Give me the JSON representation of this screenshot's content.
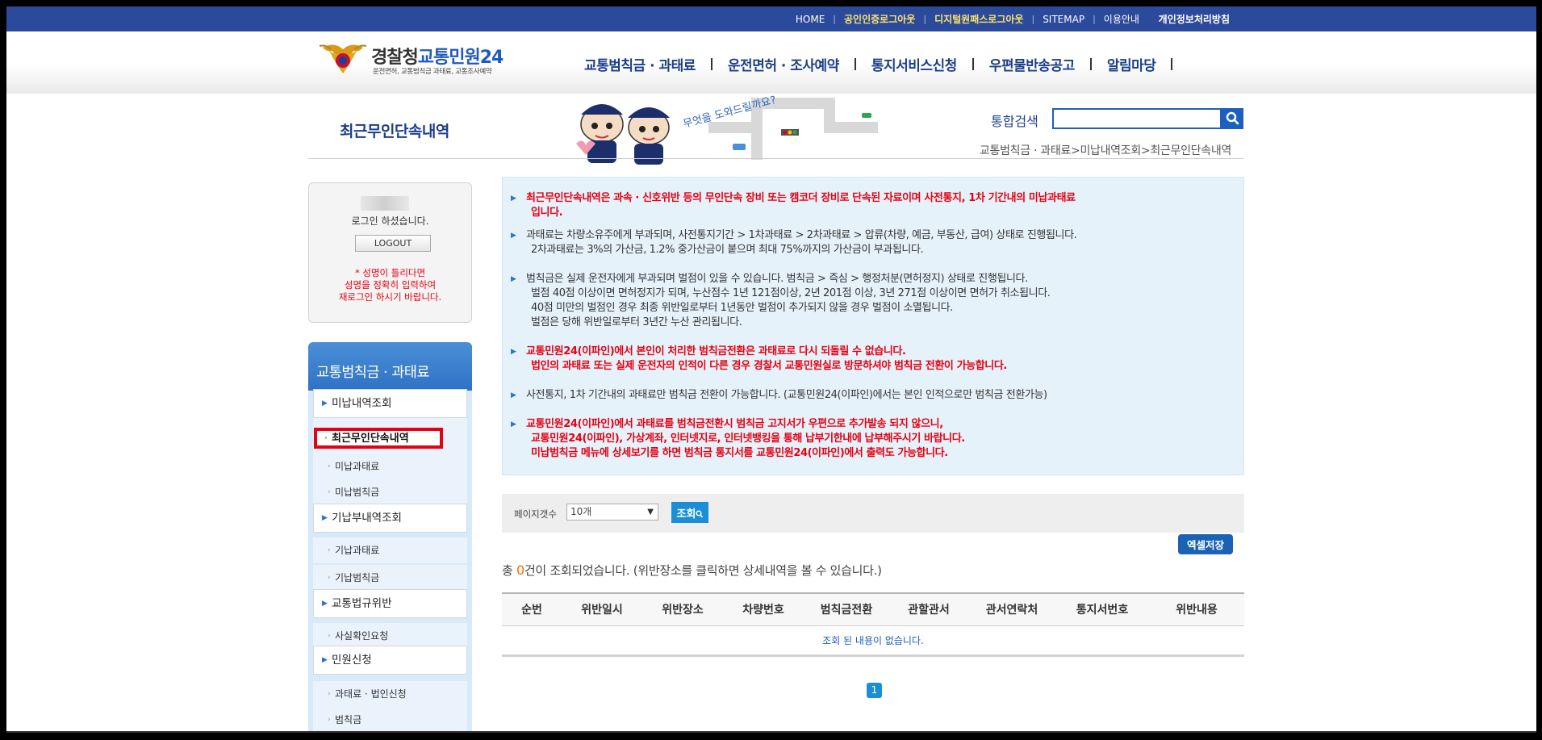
{
  "top_nav": {
    "items": [
      {
        "label": "HOME",
        "style": "normal"
      },
      {
        "label": "공인인증로그아웃",
        "style": "highlight"
      },
      {
        "label": "디지털원패스로그아웃",
        "style": "highlight"
      },
      {
        "label": "SITEMAP",
        "style": "normal"
      },
      {
        "label": "이용안내",
        "style": "normal"
      },
      {
        "label": "개인정보처리방침",
        "style": "bold"
      }
    ],
    "separator": "|"
  },
  "logo": {
    "title_a": "경찰청",
    "title_b": "교통민원24",
    "subtitle": "운전면허, 교통범칙금 과태료, 교통조사예약"
  },
  "gnb": {
    "items": [
      "교통범칙금 · 과태료",
      "운전면허 · 조사예약",
      "통지서비스신청",
      "우편물반송공고",
      "알림마당"
    ]
  },
  "page_title": "최근무인단속내역",
  "visual": {
    "caption": "무엇을 도와드릴까요?"
  },
  "search": {
    "label": "통합검색",
    "value": ""
  },
  "breadcrumb": "교통범칙금 · 과태료>미납내역조회>최근무인단속내역",
  "login": {
    "message": "로그인 하셨습니다.",
    "logout_label": "LOGOUT",
    "warning": [
      "* 성명이 틀리다면",
      "성명을 정확히 입력하여",
      "재로그인 하시기 바랍니다."
    ]
  },
  "lnb": {
    "title": "교통범칙금 · 과태료",
    "groups": [
      {
        "label": "미납내역조회",
        "children": [
          "최근무인단속내역",
          "미납과태료",
          "미납범칙금"
        ]
      },
      {
        "label": "기납부내역조회",
        "children": [
          "기납과태료",
          "기납범칙금"
        ]
      },
      {
        "label": "교통법규위반",
        "children": [
          "사실확인요청"
        ]
      },
      {
        "label": "민원신청",
        "children": [
          "과태료 · 법인신청",
          "범칙금"
        ]
      }
    ]
  },
  "notice": [
    {
      "red": true,
      "lines": [
        "최근무인단속내역은 과속 · 신호위반 등의 무인단속 장비 또는 캠코더 장비로 단속된 자료이며 사전통지, 1차 기간내의 미납과태료",
        "입니다."
      ]
    },
    {
      "red": false,
      "lines": [
        "과태료는 차량소유주에게 부과되며, 사전통지기간 > 1차과태료 > 2차과태료 > 압류(차량, 예금, 부동산, 급여) 상태로 진행됩니다.",
        "2차과태료는 3%의 가산금, 1.2% 중가산금이 붙으며 최대 75%까지의 가산금이 부과됩니다."
      ]
    },
    {
      "red": false,
      "lines": [
        "범칙금은 실제 운전자에게 부과되며 벌점이 있을 수 있습니다. 범칙금 > 즉심 > 행정처분(면허정지) 상태로 진행됩니다.",
        "벌점 40점 이상이면 면허정지가 되며, 누산점수 1년 121점이상, 2년 201점 이상, 3년 271점 이상이면 면허가 취소됩니다.",
        "40점 미만의 벌점인 경우 최종 위반일로부터 1년동안 벌점이 추가되지 않을 경우 벌점이 소멸됩니다.",
        "벌점은 당해 위반일로부터 3년간 누산 관리됩니다."
      ]
    },
    {
      "red": true,
      "lines": [
        "교통민원24(이파인)에서 본인이 처리한 범칙금전환은 과태료로 다시 되돌릴 수 없습니다.",
        "법인의 과태료 또는 실제 운전자의 인적이 다른 경우 경찰서 교통민원실로 방문하셔야 범칙금 전환이 가능합니다."
      ]
    },
    {
      "red": false,
      "lines": [
        "사전통지, 1차 기간내의 과태료만 범칙금 전환이 가능합니다. (교통민원24(이파인)에서는 본인 인적으로만 범칙금 전환가능)"
      ]
    },
    {
      "red": true,
      "lines": [
        "교통민원24(이파인)에서 과태료를 범칙금전환시 범칙금 고지서가 우편으로 추가발송 되지 않으니,",
        "교통민원24(이파인), 가상계좌, 인터넷지로, 인터넷뱅킹을 통해 납부기한내에 납부해주시기 바랍니다.",
        "미납범칙금 메뉴에 상세보기를 하면 범칙금 통지서를 교통민원24(이파인)에서 출력도 가능합니다."
      ]
    }
  ],
  "controls": {
    "page_count_label": "페이지갯수",
    "page_count_value": "10개",
    "query_label": "조회",
    "excel_label": "엑셀저장"
  },
  "summary": {
    "prefix": "총 ",
    "count": "0",
    "suffix": "건이 조회되었습니다. (위반장소를 클릭하면 상세내역을 볼 수 있습니다.)"
  },
  "table": {
    "headers": [
      "순번",
      "위반일시",
      "위반장소",
      "차량번호",
      "범칙금전환",
      "관할관서",
      "관서연락처",
      "통지서번호",
      "위반내용"
    ],
    "empty_message": "조회 된 내용이 없습니다."
  },
  "pagination": {
    "current": "1"
  },
  "colors": {
    "top_bar": "#2b4a9c",
    "accent": "#1b8ed8",
    "warning": "#e60012",
    "nav_text": "#1c3f8a"
  }
}
